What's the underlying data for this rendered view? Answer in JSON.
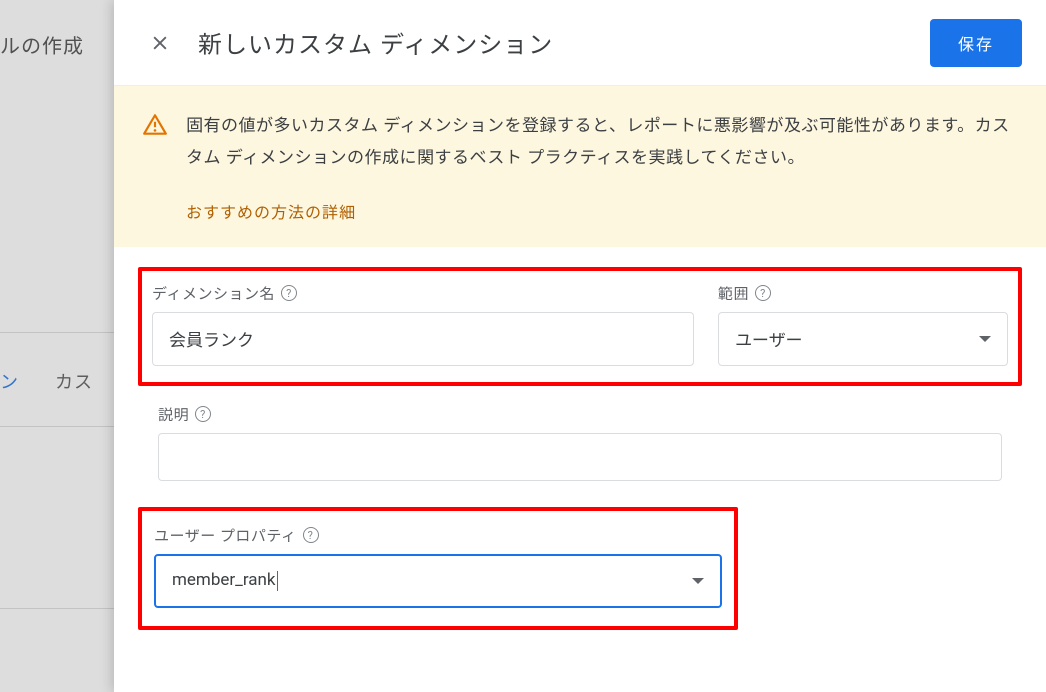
{
  "background": {
    "header_fragment": "ルの作成",
    "tab_active_fragment": "ン",
    "tab_other": "カス"
  },
  "panel": {
    "title": "新しいカスタム ディメンション",
    "save_label": "保存"
  },
  "warning": {
    "text": "固有の値が多いカスタム ディメンションを登録すると、レポートに悪影響が及ぶ可能性があります。カスタム ディメンションの作成に関するベスト プラクティスを実践してください。",
    "link": "おすすめの方法の詳細"
  },
  "fields": {
    "dimension_name": {
      "label": "ディメンション名",
      "value": "会員ランク"
    },
    "scope": {
      "label": "範囲",
      "value": "ユーザー"
    },
    "description": {
      "label": "説明",
      "value": ""
    },
    "user_property": {
      "label": "ユーザー プロパティ",
      "value": "member_rank"
    }
  }
}
